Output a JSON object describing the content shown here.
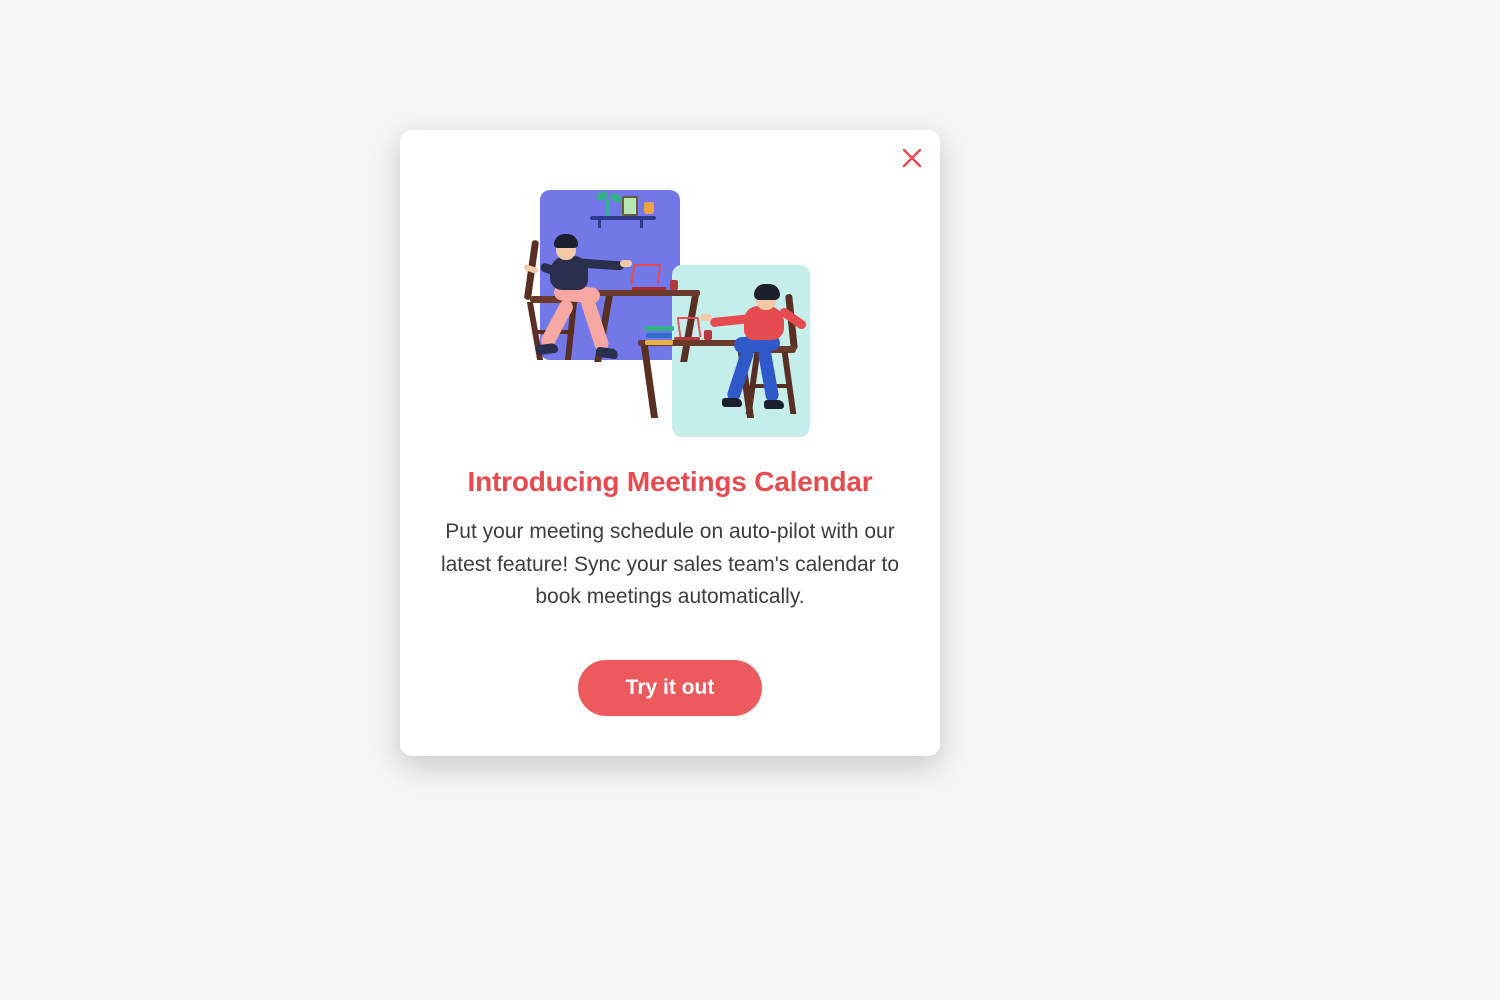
{
  "modal": {
    "title": "Introducing Meetings Calendar",
    "description": "Put your meeting schedule on auto-pilot with our latest feature! Sync your sales team's calendar to book meetings automatically.",
    "cta_label": "Try it out"
  },
  "colors": {
    "accent": "#e64b4f",
    "button": "#ec5a5e",
    "panel_primary": "#7378e8",
    "panel_secondary": "#c5eeea"
  },
  "icons": {
    "close": "close-icon"
  }
}
